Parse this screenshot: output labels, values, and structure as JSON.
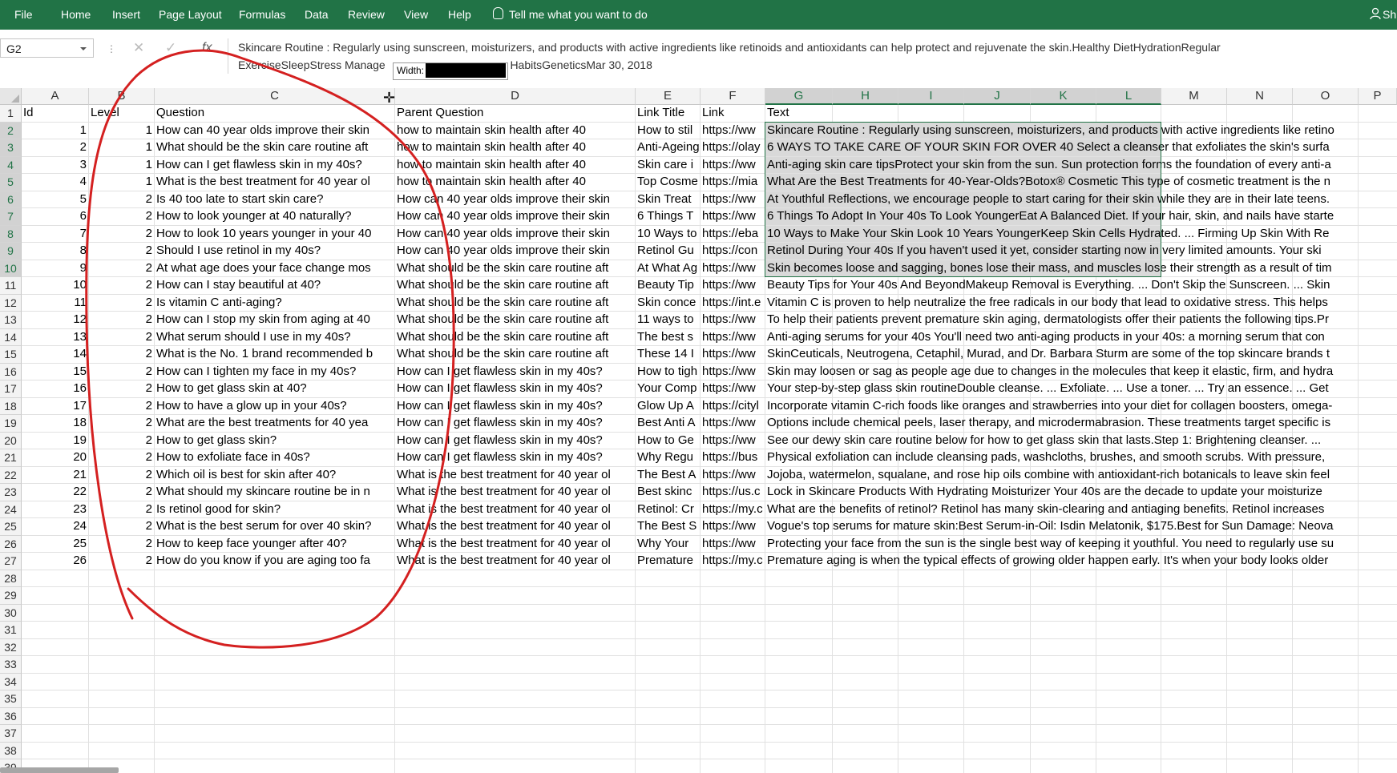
{
  "ribbon": {
    "tabs": [
      "File",
      "Home",
      "Insert",
      "Page Layout",
      "Formulas",
      "Data",
      "Review",
      "View",
      "Help"
    ],
    "tell_me": "Tell me what you want to do",
    "share": "Sh",
    "bg_color": "#217346"
  },
  "formula_bar": {
    "name_box": "G2",
    "content_line1": "Skincare Routine : Regularly using sunscreen, moisturizers, and products with active ingredients like retinoids and antioxidants can help protect and rejuvenate the skin.Healthy DietHydrationRegular",
    "content_line2": "ExerciseSleepStress Manage",
    "content_line2_tail": "HabitsGeneticsMar 30, 2018",
    "tooltip_label": "Width:"
  },
  "columns": [
    "A",
    "B",
    "C",
    "D",
    "E",
    "F",
    "G",
    "H",
    "I",
    "J",
    "K",
    "L",
    "M",
    "N",
    "O",
    "P"
  ],
  "row_numbers": [
    1,
    2,
    3,
    4,
    5,
    6,
    7,
    8,
    9,
    10,
    11,
    12,
    13,
    14,
    15,
    16,
    17,
    18,
    19,
    20,
    21,
    22,
    23,
    24,
    25,
    26,
    27,
    28,
    29,
    30,
    31,
    32,
    33,
    34,
    35,
    36,
    37,
    38,
    39
  ],
  "headers": {
    "id": "Id",
    "level": "Level",
    "question": "Question",
    "parent": "Parent Question",
    "link_title": "Link Title",
    "link": "Link",
    "text": "Text"
  },
  "rows": [
    {
      "id": "1",
      "level": "1",
      "question": "How can 40 year olds improve their skin",
      "parent": "how to maintain skin health after 40",
      "link_title": "How to stil",
      "link": "https://ww",
      "text": "Skincare Routine : Regularly using sunscreen, moisturizers, and products with active ingredients like retino"
    },
    {
      "id": "2",
      "level": "1",
      "question": "What should be the skin care routine aft",
      "parent": "how to maintain skin health after 40",
      "link_title": "Anti-Ageing",
      "link": "https://olay",
      "text": "6 WAYS TO TAKE CARE OF YOUR SKIN FOR OVER 40   Select a cleanser that exfoliates the skin's surfa"
    },
    {
      "id": "3",
      "level": "1",
      "question": "How can I get flawless skin in my 40s?",
      "parent": "how to maintain skin health after 40",
      "link_title": "Skin care i",
      "link": "https://ww",
      "text": "Anti-aging skin care tipsProtect your skin from the sun. Sun protection forms the foundation of every anti-a"
    },
    {
      "id": "4",
      "level": "1",
      "question": "What is the best treatment for 40 year ol",
      "parent": "how to maintain skin health after 40",
      "link_title": "Top Cosme",
      "link": "https://mia",
      "text": "What Are the Best Treatments for 40-Year-Olds?Botox® Cosmetic  This type of cosmetic treatment is the n"
    },
    {
      "id": "5",
      "level": "2",
      "question": "Is 40 too late to start skin care?",
      "parent": "How can 40 year olds improve their skin",
      "link_title": "Skin Treat",
      "link": "https://ww",
      "text": "At Youthful Reflections, we encourage people to start caring for their skin while they are in their late teens."
    },
    {
      "id": "6",
      "level": "2",
      "question": "How to look younger at 40 naturally?",
      "parent": "How can 40 year olds improve their skin",
      "link_title": "6 Things T",
      "link": "https://ww",
      "text": "6 Things To Adopt In Your 40s To Look YoungerEat A Balanced Diet. If your hair, skin, and nails have starte"
    },
    {
      "id": "7",
      "level": "2",
      "question": "How to look 10 years younger in your 40",
      "parent": "How can 40 year olds improve their skin",
      "link_title": "10 Ways to",
      "link": "https://eba",
      "text": "10 Ways to Make Your Skin Look 10 Years YoungerKeep Skin Cells Hydrated. ... Firming Up Skin With Re"
    },
    {
      "id": "8",
      "level": "2",
      "question": "Should I use retinol in my 40s?",
      "parent": "How can 40 year olds improve their skin",
      "link_title": "Retinol Gu",
      "link": "https://con",
      "text": "Retinol During Your 40s   If you haven't used it yet, consider starting now in very limited amounts. Your ski"
    },
    {
      "id": "9",
      "level": "2",
      "question": "At what age does your face change mos",
      "parent": "What should be the skin care routine aft",
      "link_title": "At What Ag",
      "link": "https://ww",
      "text": "Skin becomes loose and sagging, bones lose their mass, and muscles lose their strength as a result of tim"
    },
    {
      "id": "10",
      "level": "2",
      "question": "How can I stay beautiful at 40?",
      "parent": "What should be the skin care routine aft",
      "link_title": "Beauty Tip",
      "link": "https://ww",
      "text": "Beauty Tips for Your 40s And BeyondMakeup Removal is Everything. ... Don't Skip the Sunscreen. ... Skin"
    },
    {
      "id": "11",
      "level": "2",
      "question": "Is vitamin C anti-aging?",
      "parent": "What should be the skin care routine aft",
      "link_title": "Skin conce",
      "link": "https://int.e",
      "text": "Vitamin C is proven to help neutralize the free radicals in our body that lead to oxidative stress. This helps"
    },
    {
      "id": "12",
      "level": "2",
      "question": "How can I stop my skin from aging at 40",
      "parent": "What should be the skin care routine aft",
      "link_title": "11 ways to",
      "link": "https://ww",
      "text": "To help their patients prevent premature skin aging, dermatologists offer their patients the following tips.Pr"
    },
    {
      "id": "13",
      "level": "2",
      "question": "What serum should I use in my 40s?",
      "parent": "What should be the skin care routine aft",
      "link_title": "The best s",
      "link": "https://ww",
      "text": "Anti-aging serums for your 40s   You'll need two anti-aging products in your 40s: a morning serum that con"
    },
    {
      "id": "14",
      "level": "2",
      "question": "What is the No. 1 brand recommended b",
      "parent": "What should be the skin care routine aft",
      "link_title": "These 14 I",
      "link": "https://ww",
      "text": "SkinCeuticals, Neutrogena, Cetaphil, Murad, and Dr. Barbara Sturm are some of the top skincare brands t"
    },
    {
      "id": "15",
      "level": "2",
      "question": "How can I tighten my face in my 40s?",
      "parent": "How can I get flawless skin in my 40s?",
      "link_title": "How to tigh",
      "link": "https://ww",
      "text": "Skin may loosen or sag as people age due to changes in the molecules that keep it elastic, firm, and hydra"
    },
    {
      "id": "16",
      "level": "2",
      "question": "How to get glass skin at 40?",
      "parent": "How can I get flawless skin in my 40s?",
      "link_title": "Your Comp",
      "link": "https://ww",
      "text": "Your step-by-step glass skin routineDouble cleanse. ... Exfoliate. ... Use a toner. ... Try an essence. ... Get"
    },
    {
      "id": "17",
      "level": "2",
      "question": "How to have a glow up in your 40s?",
      "parent": "How can I get flawless skin in my 40s?",
      "link_title": "Glow Up A",
      "link": "https://cityl",
      "text": "Incorporate vitamin C-rich foods like oranges and strawberries into your diet for collagen boosters, omega-"
    },
    {
      "id": "18",
      "level": "2",
      "question": "What are the best treatments for 40 yea",
      "parent": "How can I get flawless skin in my 40s?",
      "link_title": "Best Anti A",
      "link": "https://ww",
      "text": "Options include chemical peels, laser therapy, and microdermabrasion. These treatments target specific is"
    },
    {
      "id": "19",
      "level": "2",
      "question": "How to get glass skin?",
      "parent": "How can I get flawless skin in my 40s?",
      "link_title": "How to Ge",
      "link": "https://ww",
      "text": "See our dewy skin care routine below for how to get glass skin that lasts.Step 1: Brightening cleanser. ..."
    },
    {
      "id": "20",
      "level": "2",
      "question": "How to exfoliate face in 40s?",
      "parent": "How can I get flawless skin in my 40s?",
      "link_title": "Why Regu",
      "link": "https://bus",
      "text": "Physical exfoliation can include cleansing pads, washcloths, brushes, and smooth scrubs. With pressure,"
    },
    {
      "id": "21",
      "level": "2",
      "question": "Which oil is best for skin after 40?",
      "parent": "What is the best treatment for 40 year ol",
      "link_title": "The Best A",
      "link": "https://ww",
      "text": "Jojoba, watermelon, squalane, and rose hip oils combine with antioxidant-rich botanicals to leave skin feel"
    },
    {
      "id": "22",
      "level": "2",
      "question": "What should my skincare routine be in n",
      "parent": "What is the best treatment for 40 year ol",
      "link_title": "Best skinc",
      "link": "https://us.c",
      "text": "Lock in Skincare Products With Hydrating Moisturizer   Your 40s are the decade to update your moisturize"
    },
    {
      "id": "23",
      "level": "2",
      "question": "Is retinol good for skin?",
      "parent": "What is the best treatment for 40 year ol",
      "link_title": "Retinol: Cr",
      "link": "https://my.c",
      "text": "What are the benefits of retinol? Retinol has many skin-clearing and antiaging benefits. Retinol increases"
    },
    {
      "id": "24",
      "level": "2",
      "question": "What is the best serum for over 40 skin?",
      "parent": "What is the best treatment for 40 year ol",
      "link_title": "The Best S",
      "link": "https://ww",
      "text": "Vogue's top serums for mature skin:Best Serum-in-Oil: Isdin Melatonik, $175.Best for Sun Damage: Neova"
    },
    {
      "id": "25",
      "level": "2",
      "question": "How to keep face younger after 40?",
      "parent": "What is the best treatment for 40 year ol",
      "link_title": "Why Your",
      "link": "https://ww",
      "text": "Protecting your face from the sun is the single best way of keeping it youthful. You need to regularly use su"
    },
    {
      "id": "26",
      "level": "2",
      "question": "How do you know if you are aging too fa",
      "parent": "What is the best treatment for 40 year ol",
      "link_title": "Premature",
      "link": "https://my.c",
      "text": "Premature aging is when the typical effects of growing older happen early. It's when your body looks older"
    }
  ],
  "colors": {
    "excel_green": "#217346",
    "selection_fill": "#d9d9d9",
    "annotation_red": "#d42020"
  }
}
